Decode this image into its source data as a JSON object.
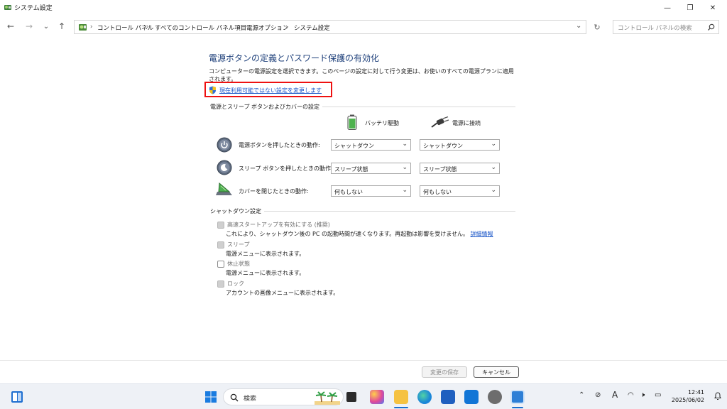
{
  "window": {
    "title": "システム設定",
    "controls": {
      "minimize": "—",
      "maximize": "❐",
      "close": "✕"
    }
  },
  "nav": {
    "back": "←",
    "forward": "→",
    "recent": "⌄",
    "up": "↑",
    "breadcrumb": [
      "コントロール パネル",
      "すべてのコントロール パネル項目",
      "電源オプション",
      "システム設定"
    ],
    "separator": "›",
    "search_placeholder": "コントロール パネルの検索"
  },
  "main": {
    "heading": "電源ボタンの定義とパスワード保護の有効化",
    "description": "コンピューターの電源設定を選択できます。このページの設定に対して行う変更は、お使いのすべての電源プランに適用されます。",
    "change_link": "現在利用可能ではない設定を変更します",
    "power_section": {
      "title": "電源とスリープ ボタンおよびカバーの設定",
      "col_battery": "バッテリ駆動",
      "col_plugged": "電源に接続",
      "rows": [
        {
          "label": "電源ボタンを押したときの動作:",
          "battery": "シャットダウン",
          "plugged": "シャットダウン",
          "icon": "power-button-icon"
        },
        {
          "label": "スリープ ボタンを押したときの動作:",
          "battery": "スリープ状態",
          "plugged": "スリープ状態",
          "icon": "sleep-button-icon"
        },
        {
          "label": "カバーを閉じたときの動作:",
          "battery": "何もしない",
          "plugged": "何もしない",
          "icon": "laptop-lid-icon"
        }
      ]
    },
    "shutdown_section": {
      "title": "シャットダウン設定",
      "items": [
        {
          "label": "高速スタートアップを有効にする (推奨)",
          "desc": "これにより、シャットダウン後の PC の起動時間が速くなります。再起動は影響を受けません。",
          "link": "詳細情報",
          "checked": true
        },
        {
          "label": "スリープ",
          "desc": "電源メニューに表示されます。",
          "checked": true
        },
        {
          "label": "休止状態",
          "desc": "電源メニューに表示されます。",
          "checked": false
        },
        {
          "label": "ロック",
          "desc": "アカウントの画像メニューに表示されます。",
          "checked": true
        }
      ]
    }
  },
  "footer": {
    "save_label": "変更の保存",
    "cancel_label": "キャンセル"
  },
  "taskbar": {
    "search_placeholder": "検索",
    "time": "12:41",
    "date": "2025/06/02",
    "ime": "A"
  },
  "colors": {
    "heading": "#1d3f7a",
    "link": "#1a56c8",
    "highlight_box": "#e11111"
  }
}
